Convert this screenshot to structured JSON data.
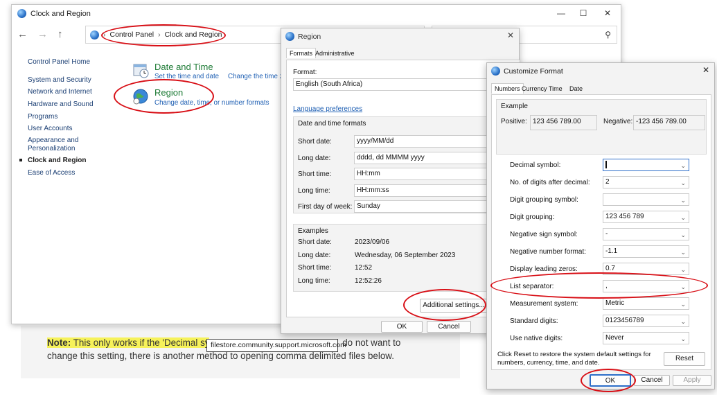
{
  "article": {
    "note_label": "Note:",
    "text_a": " This only works if the 'Decimal sy",
    "text_b": " do not want to change this setting, there is another method to opening comma delimited files below.",
    "tooltip": "filestore.community.support.microsoft.com"
  },
  "control_panel": {
    "title": "Clock and Region",
    "breadcrumb": [
      "Control Panel",
      "Clock and Region"
    ],
    "sidebar": {
      "home": "Control Panel Home",
      "items": [
        "System and Security",
        "Network and Internet",
        "Hardware and Sound",
        "Programs",
        "User Accounts",
        "Appearance and Personalization",
        "Clock and Region",
        "Ease of Access"
      ]
    },
    "categories": [
      {
        "title": "Date and Time",
        "links": [
          "Set the time and date",
          "Change the time zo"
        ]
      },
      {
        "title": "Region",
        "links": [
          "Change date, time, or number formats"
        ]
      }
    ]
  },
  "region_dialog": {
    "title": "Region",
    "tabs": [
      "Formats",
      "Administrative"
    ],
    "format_label": "Format:",
    "format_value": "English (South Africa)",
    "language_link": "Language preferences",
    "dt_group": "Date and time formats",
    "dt_rows": [
      {
        "label": "Short date:",
        "value": "yyyy/MM/dd"
      },
      {
        "label": "Long date:",
        "value": "dddd, dd MMMM yyyy"
      },
      {
        "label": "Short time:",
        "value": "HH:mm"
      },
      {
        "label": "Long time:",
        "value": "HH:mm:ss"
      },
      {
        "label": "First day of week:",
        "value": "Sunday"
      }
    ],
    "examples_group": "Examples",
    "examples": [
      {
        "label": "Short date:",
        "value": "2023/09/06"
      },
      {
        "label": "Long date:",
        "value": "Wednesday, 06 September 2023"
      },
      {
        "label": "Short time:",
        "value": "12:52"
      },
      {
        "label": "Long time:",
        "value": "12:52:26"
      }
    ],
    "additional_settings": "Additional settings...",
    "ok": "OK",
    "cancel": "Cancel"
  },
  "customize_dialog": {
    "title": "Customize Format",
    "tabs": [
      "Numbers",
      "Currency",
      "Time",
      "Date"
    ],
    "example_label": "Example",
    "positive_label": "Positive:",
    "positive_value": "123 456 789.00",
    "negative_label": "Negative:",
    "negative_value": "-123 456 789.00",
    "rows": [
      {
        "label": "Decimal symbol:",
        "value": ""
      },
      {
        "label": "No. of digits after decimal:",
        "value": "2"
      },
      {
        "label": "Digit grouping symbol:",
        "value": ""
      },
      {
        "label": "Digit grouping:",
        "value": "123 456 789"
      },
      {
        "label": "Negative sign symbol:",
        "value": "-"
      },
      {
        "label": "Negative number format:",
        "value": "-1.1"
      },
      {
        "label": "Display leading zeros:",
        "value": "0.7"
      },
      {
        "label": "List separator:",
        "value": ","
      },
      {
        "label": "Measurement system:",
        "value": "Metric"
      },
      {
        "label": "Standard digits:",
        "value": "0123456789"
      },
      {
        "label": "Use native digits:",
        "value": "Never"
      }
    ],
    "reset_text": "Click Reset to restore the system default settings for numbers, currency, time, and date.",
    "reset": "Reset",
    "ok": "OK",
    "cancel": "Cancel",
    "apply": "Apply"
  },
  "colors": {
    "annotation_red": "#d80f16",
    "link_blue": "#1e5fb3",
    "category_green": "#1e7b36",
    "highlight_yellow": "#f6f25a"
  }
}
